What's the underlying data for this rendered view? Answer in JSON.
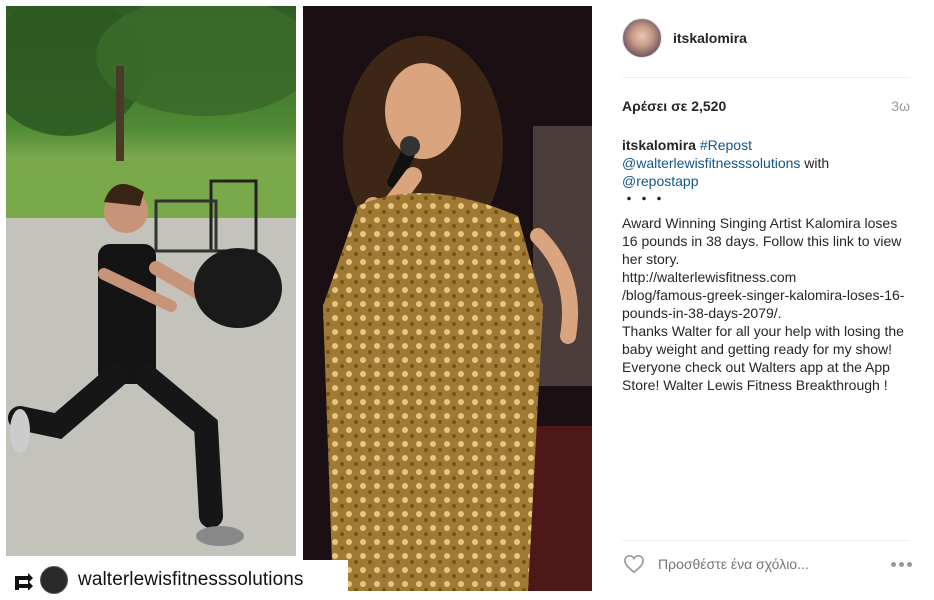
{
  "post": {
    "media_label": "walterlewisfitnesssolutions",
    "repost_icon": "repost-icon"
  },
  "sidebar": {
    "username": "itskalomira",
    "likes": "Αρέσει σε 2,520",
    "time": "3ω",
    "caption": {
      "user": "itskalomira",
      "tag": "#Repost",
      "mention1": "@walterlewisfitnesssolutions",
      "with": "with",
      "mention2": "@repostapp",
      "dots": "・・・",
      "body": "Award Winning Singing Artist Kalomira loses 16 pounds in 38 days. Follow this link to view her story.\nhttp://walterlewisfitness.com\n/blog/famous-greek-singer-kalomira-loses-16-pounds-in-38-days-2079/.\nThanks Walter for all your help with losing the baby weight and getting ready for my show! Everyone check out Walters app at the App Store! Walter Lewis Fitness Breakthrough !"
    },
    "comment_placeholder": "Προσθέστε ένα σχόλιο...",
    "icons": {
      "like": "heart-icon",
      "more": "more-options-icon"
    }
  }
}
